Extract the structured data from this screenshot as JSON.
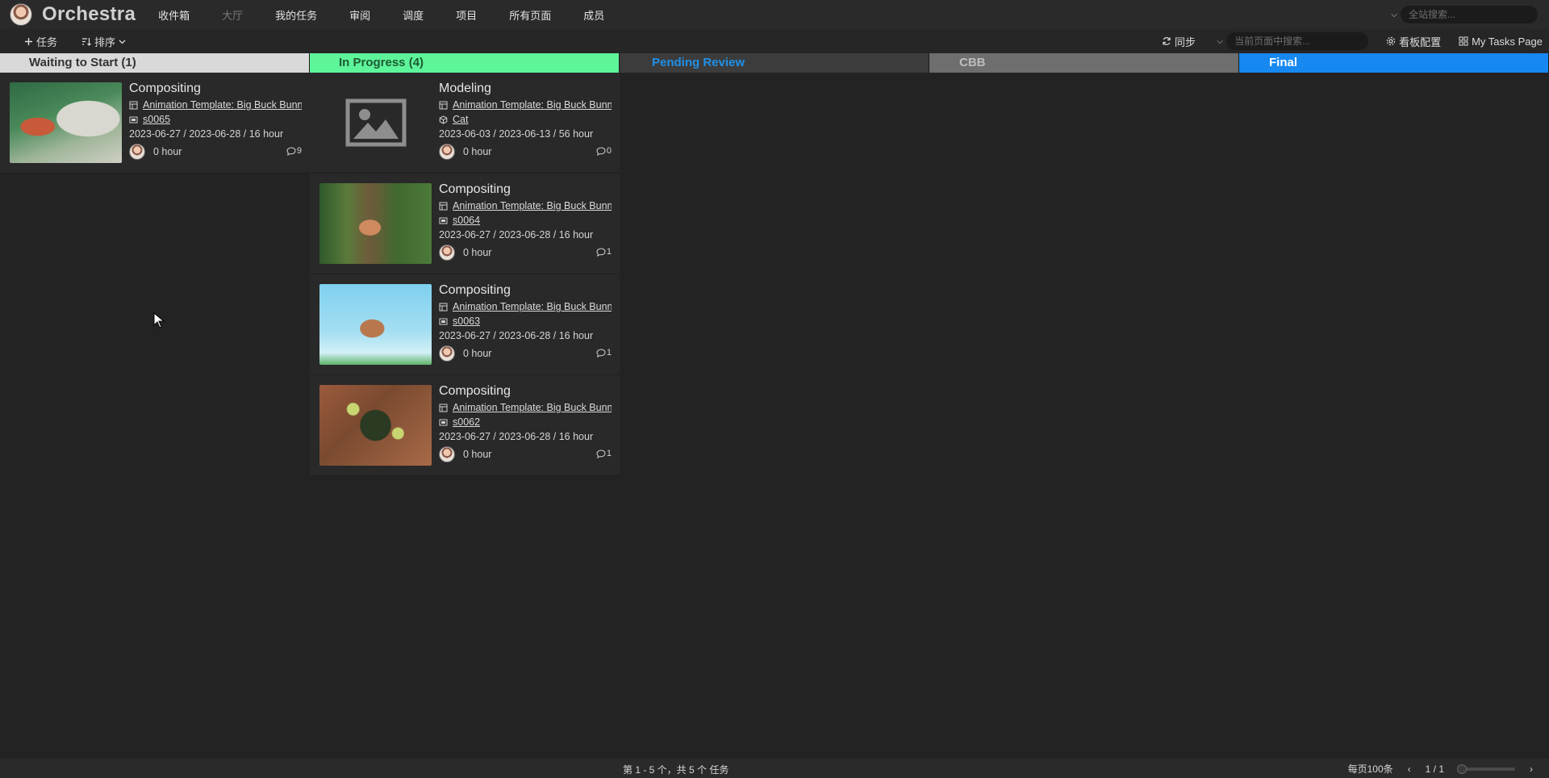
{
  "app": {
    "brand": "Orchestra"
  },
  "nav": {
    "items": [
      {
        "label": "收件箱",
        "dim": false
      },
      {
        "label": "大厅",
        "dim": true
      },
      {
        "label": "我的任务",
        "dim": false
      },
      {
        "label": "审阅",
        "dim": false
      },
      {
        "label": "调度",
        "dim": false
      },
      {
        "label": "项目",
        "dim": false
      },
      {
        "label": "所有页面",
        "dim": false
      },
      {
        "label": "成员",
        "dim": false
      }
    ],
    "global_search_placeholder": "全站搜索..."
  },
  "toolbar": {
    "add_task": "任务",
    "sort": "排序",
    "sync": "同步",
    "page_search_placeholder": "当前页面中搜索...",
    "board_config": "看板配置",
    "my_tasks_page": "My Tasks Page"
  },
  "columns": [
    {
      "title": "Waiting to Start (1)"
    },
    {
      "title": "In Progress (4)"
    },
    {
      "title": "Pending Review"
    },
    {
      "title": "CBB"
    },
    {
      "title": "Final"
    }
  ],
  "cards": {
    "waiting": [
      {
        "title": "Compositing",
        "project": "Animation Template: Big Buck Bunny",
        "entity": "s0065",
        "dates": "2023-06-27 / 2023-06-28 / 16 hour",
        "hours": "0 hour",
        "comments": "9",
        "thumb": "ape",
        "entity_icon": "shot-icon"
      }
    ],
    "progress": [
      {
        "title": "Modeling",
        "project": "Animation Template: Big Buck Bunny",
        "entity": "Cat",
        "dates": "2023-06-03 / 2023-06-13 / 56 hour",
        "hours": "0 hour",
        "comments": "0",
        "thumb": "placeholder",
        "entity_icon": "asset-icon"
      },
      {
        "title": "Compositing",
        "project": "Animation Template: Big Buck Bunny",
        "entity": "s0064",
        "dates": "2023-06-27 / 2023-06-28 / 16 hour",
        "hours": "0 hour",
        "comments": "1",
        "thumb": "tree",
        "entity_icon": "shot-icon"
      },
      {
        "title": "Compositing",
        "project": "Animation Template: Big Buck Bunny",
        "entity": "s0063",
        "dates": "2023-06-27 / 2023-06-28 / 16 hour",
        "hours": "0 hour",
        "comments": "1",
        "thumb": "sky",
        "entity_icon": "shot-icon"
      },
      {
        "title": "Compositing",
        "project": "Animation Template: Big Buck Bunny",
        "entity": "s0062",
        "dates": "2023-06-27 / 2023-06-28 / 16 hour",
        "hours": "0 hour",
        "comments": "1",
        "thumb": "ground",
        "entity_icon": "shot-icon"
      }
    ]
  },
  "footer": {
    "summary": "第 1 - 5 个，共 5 个 任务",
    "per_page": "每页100条",
    "page": "1 / 1"
  },
  "colors": {
    "waiting": "#d9d9d9",
    "in_progress": "#5ef59a",
    "pending_review_text": "#1f8fe6",
    "cbb": "#6e6e6e",
    "final": "#1688f0"
  }
}
